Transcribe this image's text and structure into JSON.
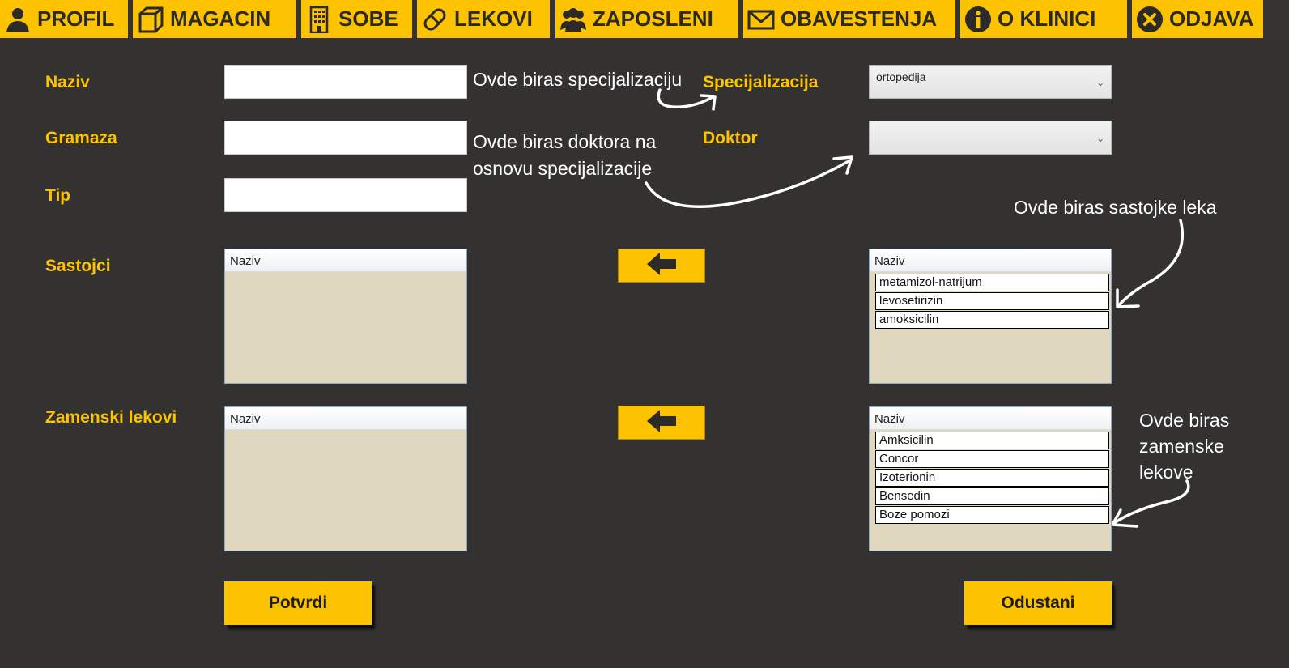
{
  "nav": {
    "profil": "PROFIL",
    "magacin": "MAGACIN",
    "sobe": "SOBE",
    "lekovi": "LEKOVI",
    "zaposleni": "ZAPOSLENI",
    "obavestenja": "OBAVESTENJA",
    "o_klinici": "O KLINICI",
    "odjava": "ODJAVA"
  },
  "form": {
    "naziv_label": "Naziv",
    "gramaza_label": "Gramaza",
    "tip_label": "Tip",
    "sastojci_label": "Sastojci",
    "zamenski_label": "Zamenski lekovi",
    "specijalizacija_label": "Specijalizacija",
    "doktor_label": "Doktor",
    "naziv_value": "",
    "gramaza_value": "",
    "tip_value": "",
    "specijalizacija_value": "ortopedija",
    "doktor_value": ""
  },
  "notes": {
    "specijalizacija": "Ovde biras specijalizaciju",
    "doktor_line1": "Ovde biras doktora na",
    "doktor_line2": "osnovu specijalizacije",
    "sastojci": "Ovde biras sastojke leka",
    "zamenski_line1": "Ovde biras",
    "zamenski_line2": "zamenske",
    "zamenski_line3": "lekove"
  },
  "lists": {
    "column_header": "Naziv",
    "selected_sastojci": [],
    "available_sastojci": [
      "metamizol-natrijum",
      "levosetirizin",
      "amoksicilin"
    ],
    "selected_zamenski": [],
    "available_zamenski": [
      "Amksicilin",
      "Concor",
      "Izoterionin",
      "Bensedin",
      "Boze pomozi"
    ]
  },
  "buttons": {
    "potvrdi": "Potvrdi",
    "odustani": "Odustani"
  },
  "colors": {
    "accent": "#fdc300",
    "background": "#333231",
    "list_bg": "#dfd8bf"
  }
}
